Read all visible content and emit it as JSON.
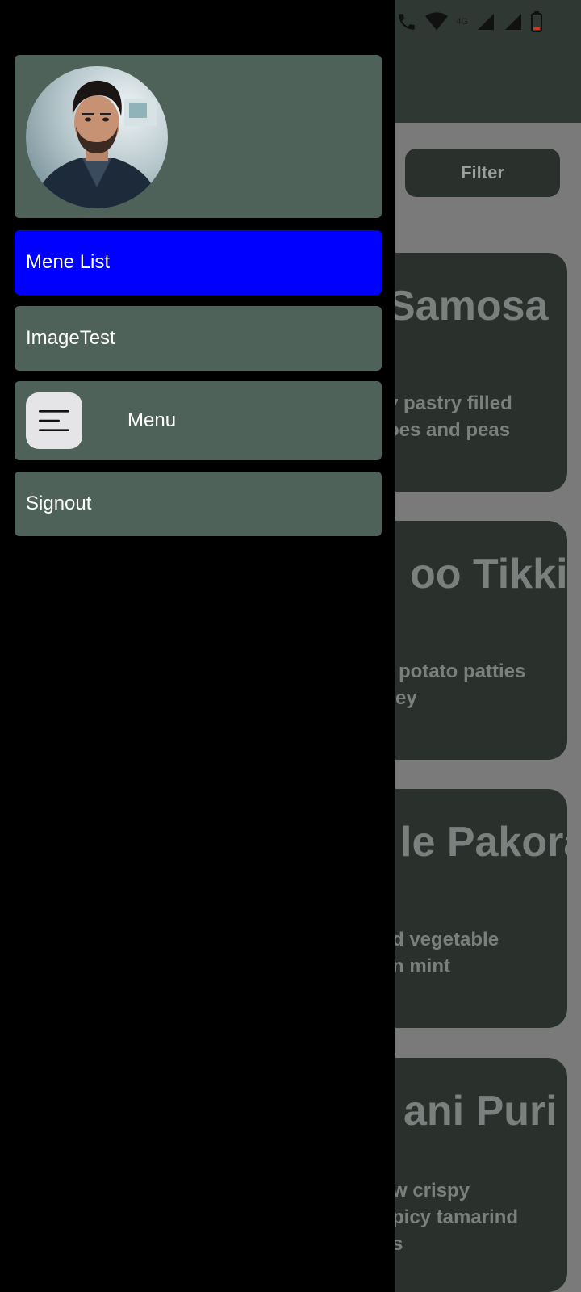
{
  "status_bar": {
    "network_label": "4G"
  },
  "background_app": {
    "filter_label": "Filter",
    "cards": [
      {
        "title": "Samosa",
        "desc_line1": "y pastry filled",
        "desc_line2": "oes and peas"
      },
      {
        "title": "oo Tikki",
        "desc_line1": "potato patties",
        "desc_line2": "ey"
      },
      {
        "title": "le Pakora",
        "desc_line1": "d vegetable",
        "desc_line2": "n mint"
      },
      {
        "title": "ani Puri",
        "desc_line1": "w crispy",
        "desc_line2": "picy tamarind",
        "desc_line3": "s"
      }
    ]
  },
  "drawer": {
    "items": [
      {
        "label": "Mene List",
        "active": true
      },
      {
        "label": "ImageTest",
        "active": false
      },
      {
        "label": "Menu",
        "icon": "menu-lines-icon",
        "active": false
      },
      {
        "label": "Signout",
        "active": false
      }
    ]
  },
  "colors": {
    "drawer_bg": "#000000",
    "item_bg": "#4e625a",
    "active_item_bg": "#0000ff",
    "app_card_bg": "#2a312d"
  }
}
